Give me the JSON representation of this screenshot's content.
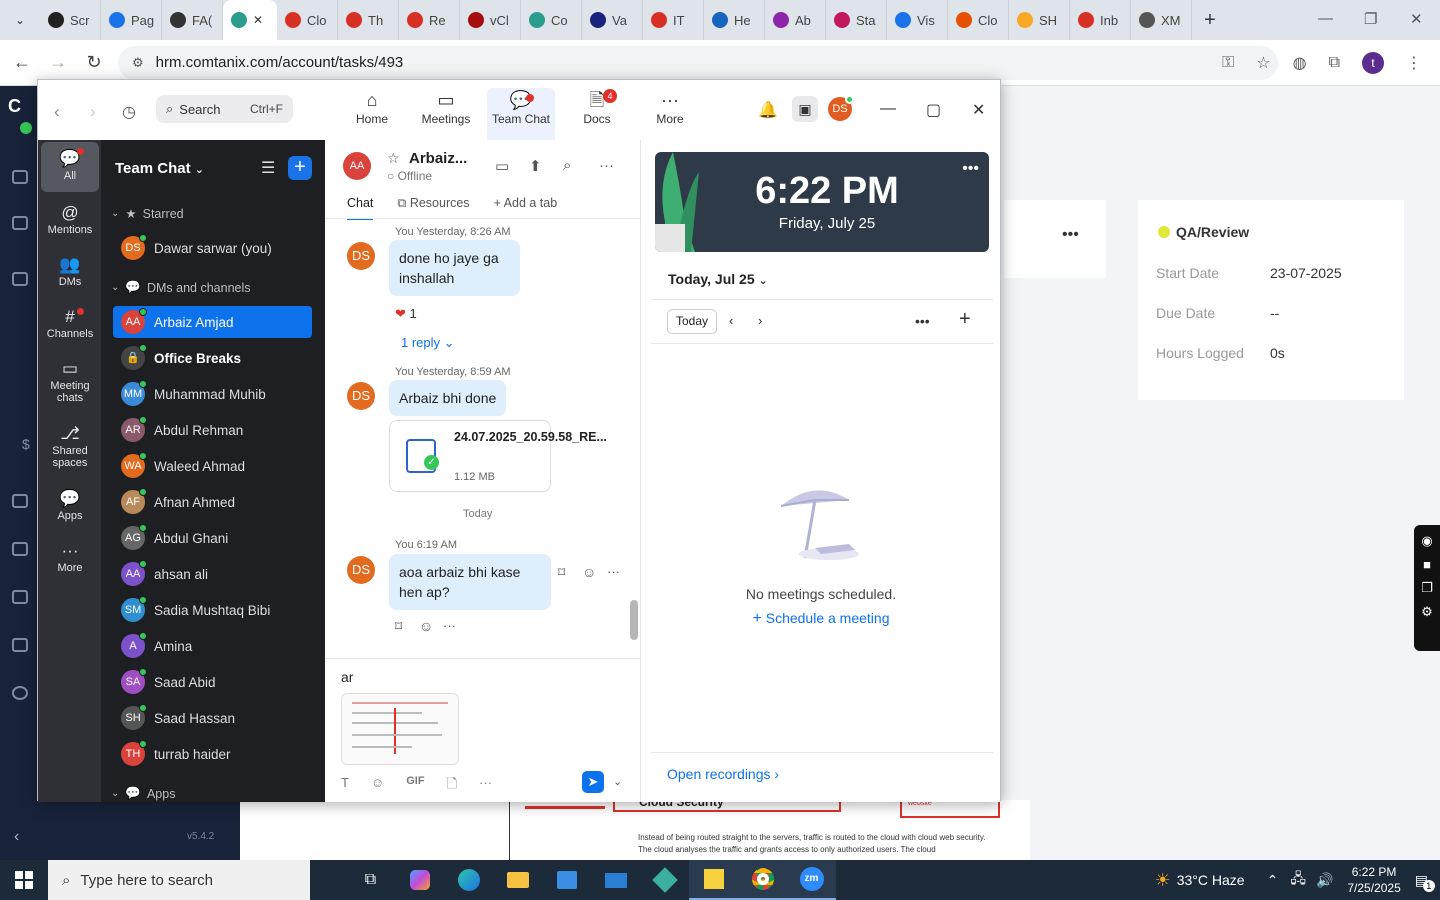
{
  "browser": {
    "tabs": [
      {
        "label": "Scr",
        "color": "#222"
      },
      {
        "label": "Pag",
        "color": "#1a73e8"
      },
      {
        "label": "FA(",
        "color": "#333"
      },
      {
        "label": "Clo",
        "color": "#d93025"
      },
      {
        "label": "Th",
        "color": "#d93025"
      },
      {
        "label": "Re",
        "color": "#d93025"
      },
      {
        "label": "vCl",
        "color": "#a50e0e"
      },
      {
        "label": "Co",
        "color": "#2a9d8f"
      },
      {
        "label": "Va",
        "color": "#1a237e"
      },
      {
        "label": "IT",
        "color": "#d93025"
      },
      {
        "label": "He",
        "color": "#1565c0"
      },
      {
        "label": "Ab",
        "color": "#8e24aa"
      },
      {
        "label": "Sta",
        "color": "#c2185b"
      },
      {
        "label": "Vis",
        "color": "#1a73e8"
      },
      {
        "label": "Clo",
        "color": "#e65100"
      },
      {
        "label": "SH",
        "color": "#f9a825"
      },
      {
        "label": "Inb",
        "color": "#d93025"
      },
      {
        "label": "XM",
        "color": "#555"
      }
    ],
    "active_tab_close": "✕",
    "url": "hrm.comtanix.com/account/tasks/493",
    "profile_initial": "t"
  },
  "hrm": {
    "status_label": "QA/Review",
    "fields": [
      {
        "label": "Start Date",
        "value": "23-07-2025"
      },
      {
        "label": "Due Date",
        "value": "--"
      },
      {
        "label": "Hours Logged",
        "value": "0s"
      }
    ],
    "bottom_heading": "Cloud Security",
    "bottom_text": "Instead of being routed straight to the servers, traffic is routed to the cloud with cloud web security. The cloud analyses the traffic and grants access to only authorized users. The cloud",
    "bottom_tag": "website",
    "version": "v5.4.2"
  },
  "zoom": {
    "search_placeholder": "Search",
    "search_shortcut": "Ctrl+F",
    "tabs": [
      {
        "label": "Home",
        "icon": "⌂"
      },
      {
        "label": "Meetings",
        "icon": "▭"
      },
      {
        "label": "Team Chat",
        "icon": "💬"
      },
      {
        "label": "Docs",
        "icon": "🗎",
        "badge": "4"
      },
      {
        "label": "More",
        "icon": "···"
      }
    ],
    "user_initials": "DS",
    "rail": [
      {
        "label": "All",
        "icon": "💬"
      },
      {
        "label": "Mentions",
        "icon": "@"
      },
      {
        "label": "DMs",
        "icon": "👥"
      },
      {
        "label": "Channels",
        "icon": "#"
      },
      {
        "label": "Meeting\nchats",
        "icon": "▭"
      },
      {
        "label": "Shared\nspaces",
        "icon": "⎇"
      },
      {
        "label": "Apps",
        "icon": "💬"
      },
      {
        "label": "More",
        "icon": "···"
      }
    ],
    "team_chat": {
      "title": "Team Chat",
      "sections": {
        "starred": "Starred",
        "dms": "DMs and channels",
        "apps": "Apps"
      },
      "starred": [
        {
          "name": "Dawar sarwar (you)",
          "initials": "DS",
          "color": "#e26b20"
        }
      ],
      "items": [
        {
          "name": "Arbaiz Amjad",
          "initials": "AA",
          "color": "#d9433b"
        },
        {
          "name": "Office Breaks",
          "initials": "🔒",
          "color": "#444"
        },
        {
          "name": "Muhammad Muhib",
          "initials": "MM",
          "color": "#3b8bd9"
        },
        {
          "name": "Abdul Rehman",
          "initials": "AR",
          "color": "#8a5a6a"
        },
        {
          "name": "Waleed Ahmad",
          "initials": "WA",
          "color": "#e26b20"
        },
        {
          "name": "Afnan Ahmed",
          "initials": "AF",
          "color": "#b88a5a"
        },
        {
          "name": "Abdul Ghani",
          "initials": "AG",
          "color": "#666"
        },
        {
          "name": "ahsan ali",
          "initials": "AA",
          "color": "#7b52c9"
        },
        {
          "name": "Sadia Mushtaq Bibi",
          "initials": "SM",
          "color": "#2f8fd0"
        },
        {
          "name": "Amina",
          "initials": "A",
          "color": "#7b52c9"
        },
        {
          "name": "Saad Abid",
          "initials": "SA",
          "color": "#a04fc2"
        },
        {
          "name": "Saad Hassan",
          "initials": "SH",
          "color": "#555"
        },
        {
          "name": "turrab haider",
          "initials": "TH",
          "color": "#d9433b"
        }
      ]
    },
    "chat": {
      "contact_initials": "AA",
      "contact_name": "Arbaiz...",
      "contact_status": "Offline",
      "tabs": {
        "chat": "Chat",
        "resources": "Resources",
        "add": "Add a tab"
      },
      "messages": [
        {
          "meta": "You Yesterday, 8:26 AM",
          "text": "done ho jaye ga inshallah",
          "reaction_count": "1",
          "replies": "1 reply"
        },
        {
          "meta": "You Yesterday, 8:59 AM",
          "text": "Arbaiz bhi done",
          "file_name": "24.07.2025_20.59.58_RE...",
          "file_size": "1.12 MB"
        },
        {
          "meta": "You 6:19 AM",
          "text": "aoa arbaiz bhi kase hen ap?"
        }
      ],
      "day_divider": "Today",
      "draft": "ar"
    },
    "calendar": {
      "time": "6:22 PM",
      "date": "Friday, July 25",
      "header": "Today, Jul 25",
      "today_button": "Today",
      "empty_text": "No meetings scheduled.",
      "schedule_link": "Schedule a meeting",
      "open_recordings": "Open recordings"
    }
  },
  "taskbar": {
    "search_placeholder": "Type here to search",
    "weather": "33°C  Haze",
    "time": "6:22 PM",
    "date": "7/25/2025",
    "notif_count": "1"
  }
}
